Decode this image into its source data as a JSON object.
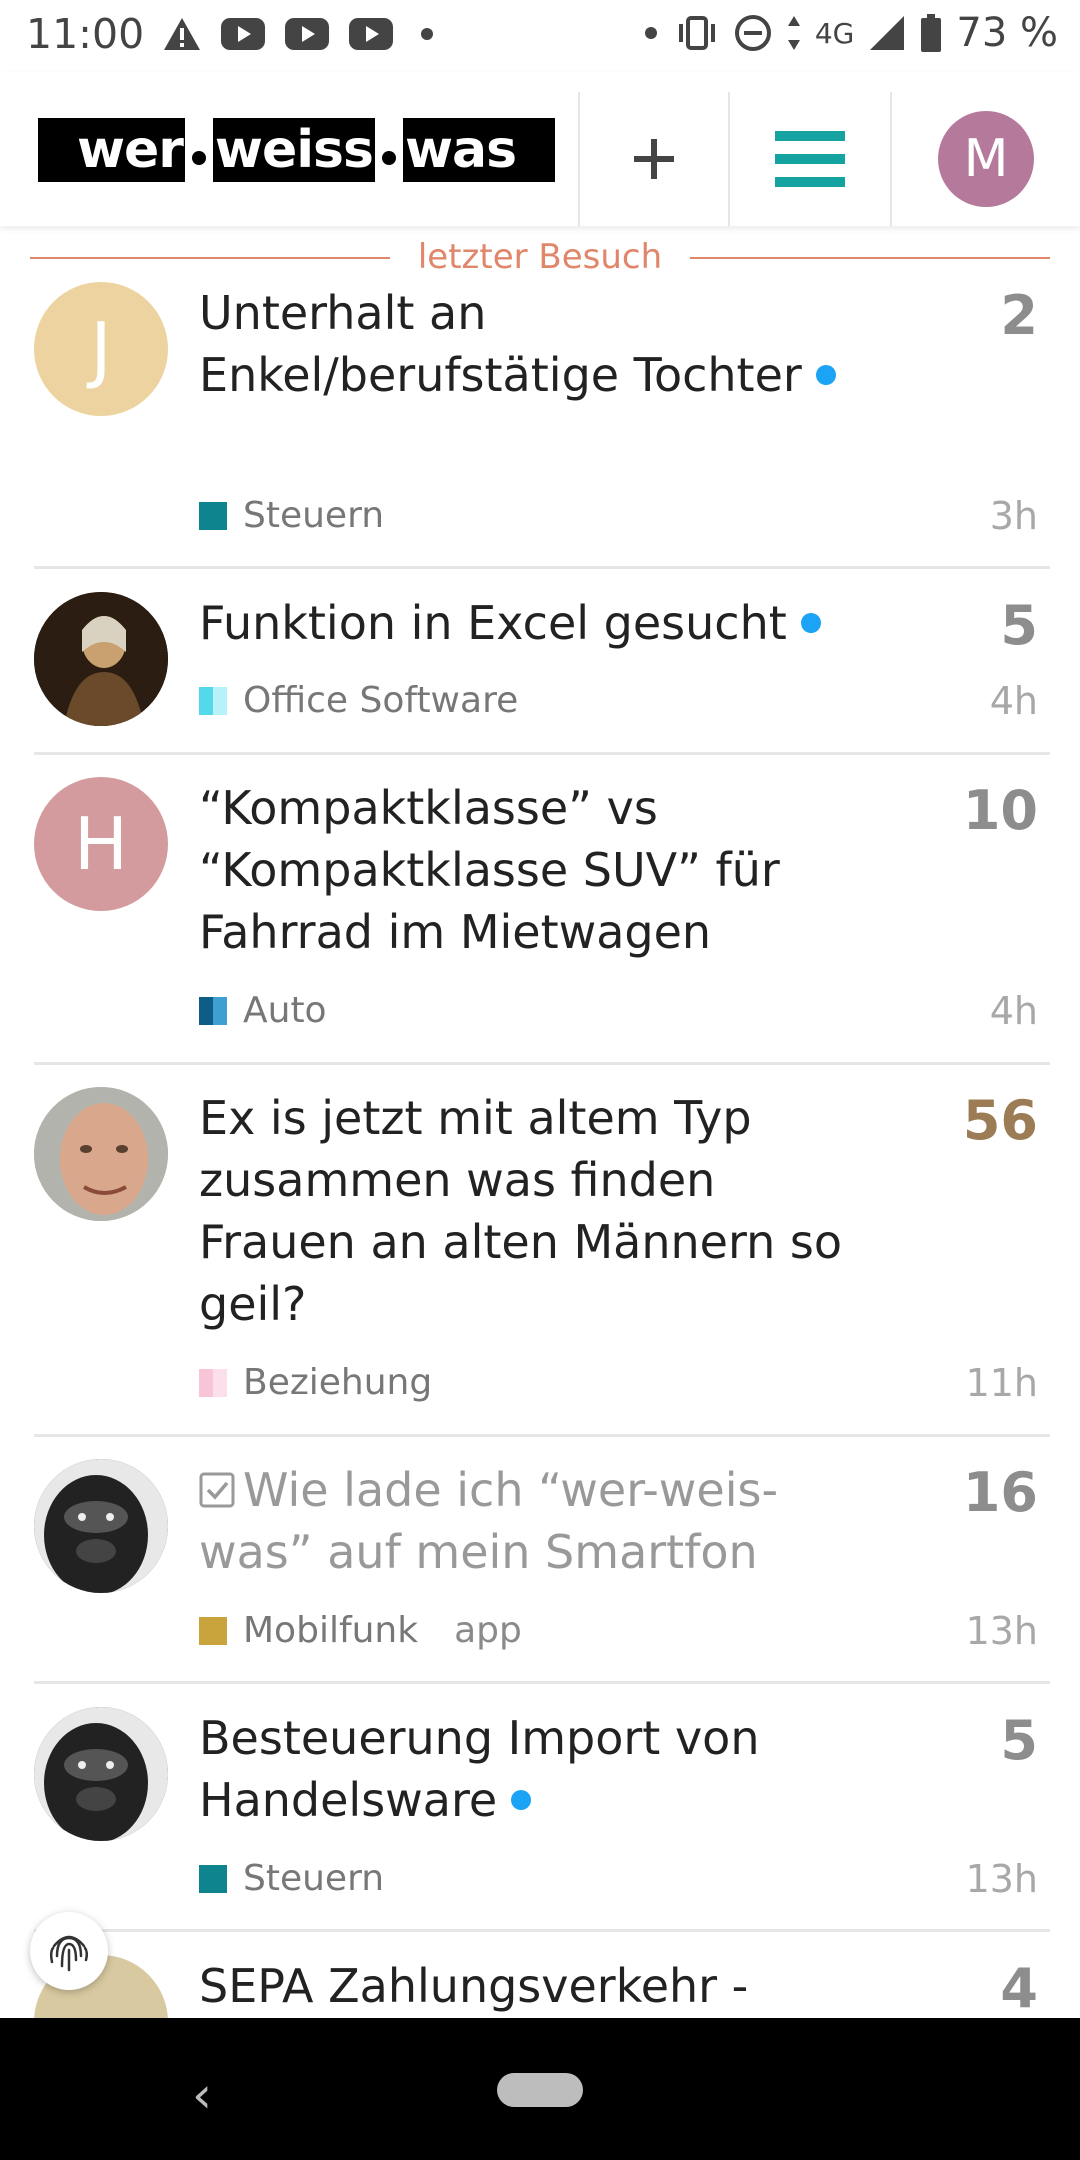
{
  "status_bar": {
    "time": "11:00",
    "network": "4G",
    "battery": "73 %",
    "left_icons": [
      "warning-icon",
      "youtube-icon",
      "youtube-icon",
      "youtube-icon",
      "dot-icon"
    ],
    "right_icons": [
      "dot-icon",
      "vibrate-icon",
      "dnd-icon",
      "data-arrows-icon",
      "signal-icon",
      "battery-icon"
    ]
  },
  "header": {
    "logo": {
      "part1": "wer",
      "part2": "weiss",
      "part3": "was"
    },
    "new_topic_icon": "plus-icon",
    "menu_icon": "hamburger-icon",
    "user_avatar_letter": "M",
    "colors": {
      "menu": "#14a3a0",
      "avatar": "#b57a9b"
    }
  },
  "last_visit_label": "letzter Besuch",
  "topics": [
    {
      "title": "Unterhalt an Enkel/berufstätige Tochter",
      "avatar_letter": "J",
      "avatar_color": "#ecd3a0",
      "unread": true,
      "replies": "2",
      "category": "Steuern",
      "category_color": "#0e858e",
      "age": "3h"
    },
    {
      "title": "Funktion in Excel gesucht",
      "avatar_letter": "",
      "avatar_color": "#5a3b22",
      "unread": true,
      "replies": "5",
      "category": "Office Software",
      "category_color": "#7fe3f2",
      "age": "4h"
    },
    {
      "title": "“Kompaktklasse” vs “Kompaktklasse SUV” für Fahrrad im Mietwagen",
      "avatar_letter": "H",
      "avatar_color": "#d49b9e",
      "unread": false,
      "replies": "10",
      "category": "Auto",
      "category_color": "#1a6f9a",
      "age": "4h"
    },
    {
      "title": "Ex is jetzt mit altem Typ zusammen was finden Frauen an alten Männern so geil?",
      "avatar_letter": "",
      "avatar_color": "#caa088",
      "unread": false,
      "replies": "56",
      "category": "Beziehung",
      "category_color": "#f7c4d8",
      "age": "11h"
    },
    {
      "title": "Wie lade ich “wer-weis-was” auf mein Smartfon",
      "avatar_letter": "",
      "avatar_color": "#3c3c3c",
      "solved": true,
      "unread": false,
      "replies": "16",
      "category": "Mobilfunk",
      "category_color": "#c9a43d",
      "tag": "app",
      "age": "13h"
    },
    {
      "title": "Besteuerung Import von Handelsware",
      "avatar_letter": "",
      "avatar_color": "#3c3c3c",
      "unread": true,
      "replies": "5",
      "category": "Steuern",
      "category_color": "#0e858e",
      "age": "13h"
    },
    {
      "title": "SEPA Zahlungsverkehr -",
      "avatar_letter": "",
      "avatar_color": "#d8c9a0",
      "unread": false,
      "replies": "4",
      "category": "",
      "category_color": "",
      "age": ""
    }
  ],
  "fab_icon": "fingerprint-icon",
  "nav": {
    "back_icon": "chevron-left-icon",
    "home_icon": "home-pill-icon"
  }
}
